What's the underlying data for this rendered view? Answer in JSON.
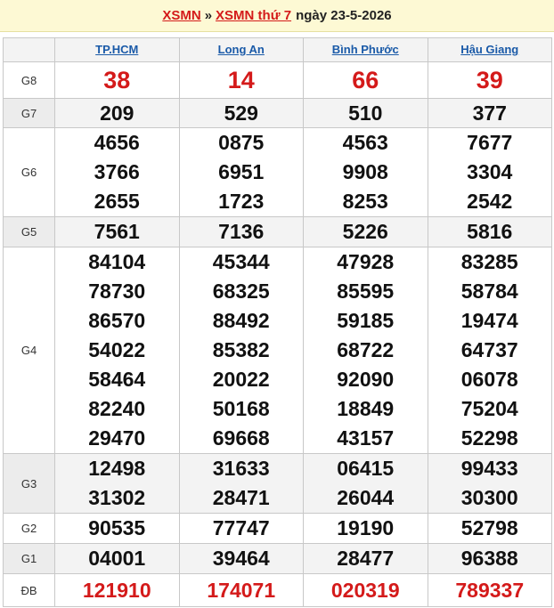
{
  "header": {
    "link1": "XSMN",
    "separator": "»",
    "link2": "XSMN thứ 7",
    "date_text": "ngày 23-5-2026"
  },
  "provinces": [
    "TP.HCM",
    "Long An",
    "Bình Phước",
    "Hậu Giang"
  ],
  "prizes": [
    {
      "label": "G8",
      "values": [
        [
          "38"
        ],
        [
          "14"
        ],
        [
          "66"
        ],
        [
          "39"
        ]
      ]
    },
    {
      "label": "G7",
      "values": [
        [
          "209"
        ],
        [
          "529"
        ],
        [
          "510"
        ],
        [
          "377"
        ]
      ]
    },
    {
      "label": "G6",
      "values": [
        [
          "4656",
          "3766",
          "2655"
        ],
        [
          "0875",
          "6951",
          "1723"
        ],
        [
          "4563",
          "9908",
          "8253"
        ],
        [
          "7677",
          "3304",
          "2542"
        ]
      ]
    },
    {
      "label": "G5",
      "values": [
        [
          "7561"
        ],
        [
          "7136"
        ],
        [
          "5226"
        ],
        [
          "5816"
        ]
      ]
    },
    {
      "label": "G4",
      "values": [
        [
          "84104",
          "78730",
          "86570",
          "54022",
          "58464",
          "82240",
          "29470"
        ],
        [
          "45344",
          "68325",
          "88492",
          "85382",
          "20022",
          "50168",
          "69668"
        ],
        [
          "47928",
          "85595",
          "59185",
          "68722",
          "92090",
          "18849",
          "43157"
        ],
        [
          "83285",
          "58784",
          "19474",
          "64737",
          "06078",
          "75204",
          "52298"
        ]
      ]
    },
    {
      "label": "G3",
      "values": [
        [
          "12498",
          "31302"
        ],
        [
          "31633",
          "28471"
        ],
        [
          "06415",
          "26044"
        ],
        [
          "99433",
          "30300"
        ]
      ]
    },
    {
      "label": "G2",
      "values": [
        [
          "90535"
        ],
        [
          "77747"
        ],
        [
          "19190"
        ],
        [
          "52798"
        ]
      ]
    },
    {
      "label": "G1",
      "values": [
        [
          "04001"
        ],
        [
          "39464"
        ],
        [
          "28477"
        ],
        [
          "96388"
        ]
      ]
    },
    {
      "label": "ĐB",
      "values": [
        [
          "121910"
        ],
        [
          "174071"
        ],
        [
          "020319"
        ],
        [
          "789337"
        ]
      ]
    }
  ],
  "colors": {
    "accent_red": "#d41a1a",
    "link_blue": "#1a5aa8",
    "header_bg": "#fdf9d4"
  }
}
